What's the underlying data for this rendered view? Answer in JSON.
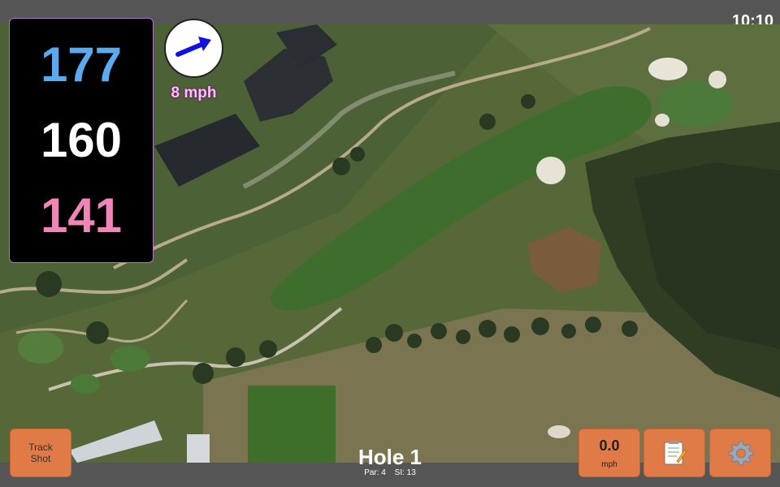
{
  "status": {
    "time": "10:10"
  },
  "distances": {
    "back": "177",
    "center": "160",
    "front": "141"
  },
  "wind": {
    "speed": "8 mph",
    "icon": "arrow-right-up-icon"
  },
  "buttons": {
    "track_shot": "Track Shot",
    "speed_value": "0.0",
    "speed_unit": "mph",
    "notes_icon": "notepad-icon",
    "settings_icon": "gear-icon"
  },
  "hole": {
    "title": "Hole 1",
    "par": "Par: 4",
    "si": "SI: 13"
  },
  "colors": {
    "back": "#5aaaf0",
    "center": "#ffffff",
    "front": "#f085b8",
    "button": "#e07a47",
    "bars": "#555555"
  }
}
